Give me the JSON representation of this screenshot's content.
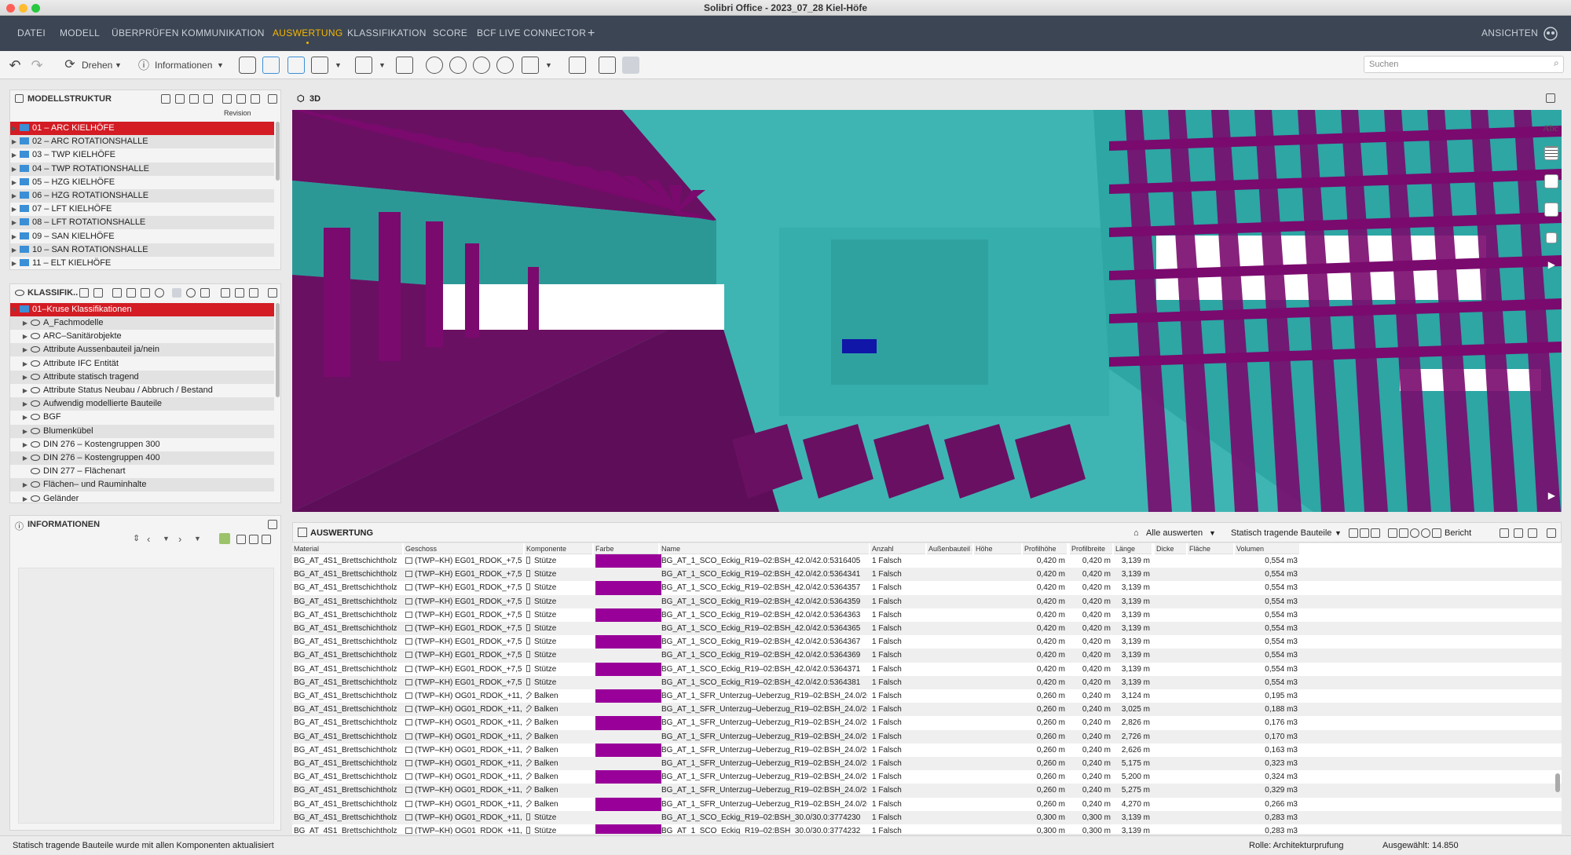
{
  "window": {
    "title": "Solibri Office - 2023_07_28 Kiel-Höfe"
  },
  "menu": {
    "items": [
      "DATEI",
      "MODELL",
      "ÜBERPRÜFEN",
      "KOMMUNIKATION",
      "AUSWERTUNG",
      "KLASSIFIKATION",
      "SCORE",
      "BCF LIVE CONNECTOR"
    ],
    "active": "AUSWERTUNG",
    "plus": "+",
    "right_label": "ANSICHTEN"
  },
  "toolbar": {
    "rotate_label": "Drehen",
    "info_label": "Informationen",
    "search_placeholder": "Suchen"
  },
  "model_structure": {
    "title": "MODELLSTRUKTUR",
    "column": "Revision",
    "items": [
      "01 – ARC KIELHÖFE",
      "02 – ARC ROTATIONSHALLE",
      "03 – TWP KIELHÖFE",
      "04 – TWP ROTATIONSHALLE",
      "05 – HZG KIELHÖFE",
      "06 – HZG ROTATIONSHALLE",
      "07 – LFT KIELHÖFE",
      "08 – LFT ROTATIONSHALLE",
      "09 – SAN KIELHÖFE",
      "10 – SAN ROTATIONSHALLE",
      "11 – ELT KIELHÖFE"
    ]
  },
  "classification": {
    "title": "KLASSIFIK..",
    "root": "01–Kruse Klassifikationen",
    "items": [
      "A_Fachmodelle",
      "ARC–Sanitärobjekte",
      "Attribute Aussenbauteil ja/nein",
      "Attribute IFC Entität",
      "Attribute statisch tragend",
      "Attribute Status Neubau / Abbruch / Bestand",
      "Aufwendig modellierte Bauteile",
      "BGF",
      "Blumenkübel",
      "DIN 276 – Kostengruppen 300",
      "DIN 276 – Kostengruppen 400",
      "DIN 277 – Flächenart",
      "Flächen– und Rauminhalte",
      "Geländer"
    ]
  },
  "information": {
    "title": "INFORMATIONEN"
  },
  "view3d": {
    "title": "3D",
    "abc": "Abc"
  },
  "report": {
    "title": "AUSWERTUNG",
    "evaluate_label": "Alle auswerten",
    "preset_label": "Statisch tragende Bauteile",
    "report_label": "Bericht",
    "columns": [
      "Material",
      "Geschoss",
      "Komponente",
      "Farbe",
      "Name",
      "Anzahl",
      "Außenbauteil Ja ...",
      "Höhe",
      "Profilhöhe",
      "Profilbreite",
      "Länge",
      "Dicke",
      "Fläche",
      "Volumen"
    ],
    "color": "#990099",
    "rows": [
      [
        "BG_AT_4S1_Brettschichtholz",
        "(TWP–KH) EG01_RDOK_+7,50",
        "Stütze",
        "BG_AT_1_SCO_Eckig_R19–02:BSH_42.0/42.0:5316405",
        "1 Falsch",
        "0,420 m",
        "0,420 m",
        "3,139 m",
        "0,554 m3"
      ],
      [
        "BG_AT_4S1_Brettschichtholz",
        "(TWP–KH) EG01_RDOK_+7,50",
        "Stütze",
        "BG_AT_1_SCO_Eckig_R19–02:BSH_42.0/42.0:5364341",
        "1 Falsch",
        "0,420 m",
        "0,420 m",
        "3,139 m",
        "0,554 m3"
      ],
      [
        "BG_AT_4S1_Brettschichtholz",
        "(TWP–KH) EG01_RDOK_+7,50",
        "Stütze",
        "BG_AT_1_SCO_Eckig_R19–02:BSH_42.0/42.0:5364357",
        "1 Falsch",
        "0,420 m",
        "0,420 m",
        "3,139 m",
        "0,554 m3"
      ],
      [
        "BG_AT_4S1_Brettschichtholz",
        "(TWP–KH) EG01_RDOK_+7,50",
        "Stütze",
        "BG_AT_1_SCO_Eckig_R19–02:BSH_42.0/42.0:5364359",
        "1 Falsch",
        "0,420 m",
        "0,420 m",
        "3,139 m",
        "0,554 m3"
      ],
      [
        "BG_AT_4S1_Brettschichtholz",
        "(TWP–KH) EG01_RDOK_+7,50",
        "Stütze",
        "BG_AT_1_SCO_Eckig_R19–02:BSH_42.0/42.0:5364363",
        "1 Falsch",
        "0,420 m",
        "0,420 m",
        "3,139 m",
        "0,554 m3"
      ],
      [
        "BG_AT_4S1_Brettschichtholz",
        "(TWP–KH) EG01_RDOK_+7,50",
        "Stütze",
        "BG_AT_1_SCO_Eckig_R19–02:BSH_42.0/42.0:5364365",
        "1 Falsch",
        "0,420 m",
        "0,420 m",
        "3,139 m",
        "0,554 m3"
      ],
      [
        "BG_AT_4S1_Brettschichtholz",
        "(TWP–KH) EG01_RDOK_+7,50",
        "Stütze",
        "BG_AT_1_SCO_Eckig_R19–02:BSH_42.0/42.0:5364367",
        "1 Falsch",
        "0,420 m",
        "0,420 m",
        "3,139 m",
        "0,554 m3"
      ],
      [
        "BG_AT_4S1_Brettschichtholz",
        "(TWP–KH) EG01_RDOK_+7,50",
        "Stütze",
        "BG_AT_1_SCO_Eckig_R19–02:BSH_42.0/42.0:5364369",
        "1 Falsch",
        "0,420 m",
        "0,420 m",
        "3,139 m",
        "0,554 m3"
      ],
      [
        "BG_AT_4S1_Brettschichtholz",
        "(TWP–KH) EG01_RDOK_+7,50",
        "Stütze",
        "BG_AT_1_SCO_Eckig_R19–02:BSH_42.0/42.0:5364371",
        "1 Falsch",
        "0,420 m",
        "0,420 m",
        "3,139 m",
        "0,554 m3"
      ],
      [
        "BG_AT_4S1_Brettschichtholz",
        "(TWP–KH) EG01_RDOK_+7,50",
        "Stütze",
        "BG_AT_1_SCO_Eckig_R19–02:BSH_42.0/42.0:5364381",
        "1 Falsch",
        "0,420 m",
        "0,420 m",
        "3,139 m",
        "0,554 m3"
      ],
      [
        "BG_AT_4S1_Brettschichtholz",
        "(TWP–KH) OG01_RDOK_+11,70",
        "Balken",
        "BG_AT_1_SFR_Unterzug–Ueberzug_R19–02:BSH_24.0/26.0:5317845",
        "1 Falsch",
        "0,260 m",
        "0,240 m",
        "3,124 m",
        "0,195 m3"
      ],
      [
        "BG_AT_4S1_Brettschichtholz",
        "(TWP–KH) OG01_RDOK_+11,70",
        "Balken",
        "BG_AT_1_SFR_Unterzug–Ueberzug_R19–02:BSH_24.0/26.0:5317847",
        "1 Falsch",
        "0,260 m",
        "0,240 m",
        "3,025 m",
        "0,188 m3"
      ],
      [
        "BG_AT_4S1_Brettschichtholz",
        "(TWP–KH) OG01_RDOK_+11,70",
        "Balken",
        "BG_AT_1_SFR_Unterzug–Ueberzug_R19–02:BSH_24.0/26.0:5317851",
        "1 Falsch",
        "0,260 m",
        "0,240 m",
        "2,826 m",
        "0,176 m3"
      ],
      [
        "BG_AT_4S1_Brettschichtholz",
        "(TWP–KH) OG01_RDOK_+11,70",
        "Balken",
        "BG_AT_1_SFR_Unterzug–Ueberzug_R19–02:BSH_24.0/26.0:5317853",
        "1 Falsch",
        "0,260 m",
        "0,240 m",
        "2,726 m",
        "0,170 m3"
      ],
      [
        "BG_AT_4S1_Brettschichtholz",
        "(TWP–KH) OG01_RDOK_+11,70",
        "Balken",
        "BG_AT_1_SFR_Unterzug–Ueberzug_R19–02:BSH_24.0/26.0:5317855",
        "1 Falsch",
        "0,260 m",
        "0,240 m",
        "2,626 m",
        "0,163 m3"
      ],
      [
        "BG_AT_4S1_Brettschichtholz",
        "(TWP–KH) OG01_RDOK_+11,70",
        "Balken",
        "BG_AT_1_SFR_Unterzug–Ueberzug_R19–02:BSH_24.0/26.0:5358042",
        "1 Falsch",
        "0,260 m",
        "0,240 m",
        "5,175 m",
        "0,323 m3"
      ],
      [
        "BG_AT_4S1_Brettschichtholz",
        "(TWP–KH) OG01_RDOK_+11,70",
        "Balken",
        "BG_AT_1_SFR_Unterzug–Ueberzug_R19–02:BSH_24.0/26.0:5358044",
        "1 Falsch",
        "0,260 m",
        "0,240 m",
        "5,200 m",
        "0,324 m3"
      ],
      [
        "BG_AT_4S1_Brettschichtholz",
        "(TWP–KH) OG01_RDOK_+11,70",
        "Balken",
        "BG_AT_1_SFR_Unterzug–Ueberzug_R19–02:BSH_24.0/26.0:5358046",
        "1 Falsch",
        "0,260 m",
        "0,240 m",
        "5,275 m",
        "0,329 m3"
      ],
      [
        "BG_AT_4S1_Brettschichtholz",
        "(TWP–KH) OG01_RDOK_+11,70",
        "Balken",
        "BG_AT_1_SFR_Unterzug–Ueberzug_R19–02:BSH_24.0/26.0:5435980",
        "1 Falsch",
        "0,260 m",
        "0,240 m",
        "4,270 m",
        "0,266 m3"
      ],
      [
        "BG_AT_4S1_Brettschichtholz",
        "(TWP–KH) OG01_RDOK_+11,70",
        "Stütze",
        "BG_AT_1_SCO_Eckig_R19–02:BSH_30.0/30.0:3774230",
        "1 Falsch",
        "0,300 m",
        "0,300 m",
        "3,139 m",
        "0,283 m3"
      ],
      [
        "BG_AT_4S1_Brettschichtholz",
        "(TWP–KH) OG01_RDOK_+11,70",
        "Stütze",
        "BG_AT_1_SCO_Eckig_R19–02:BSH_30.0/30.0:3774232",
        "1 Falsch",
        "0,300 m",
        "0,300 m",
        "3,139 m",
        "0,283 m3"
      ]
    ]
  },
  "status": {
    "message": "Statisch tragende Bauteile wurde mit allen Komponenten aktualisiert",
    "role": "Rolle: Architekturprufung",
    "selected": "Ausgewählt: 14.850"
  },
  "colors": {
    "menubar": "#3c4553",
    "accent": "#f5b700",
    "selection": "#d31c24",
    "purple": "#7a0a6e",
    "teal": "#3fb5b3"
  }
}
